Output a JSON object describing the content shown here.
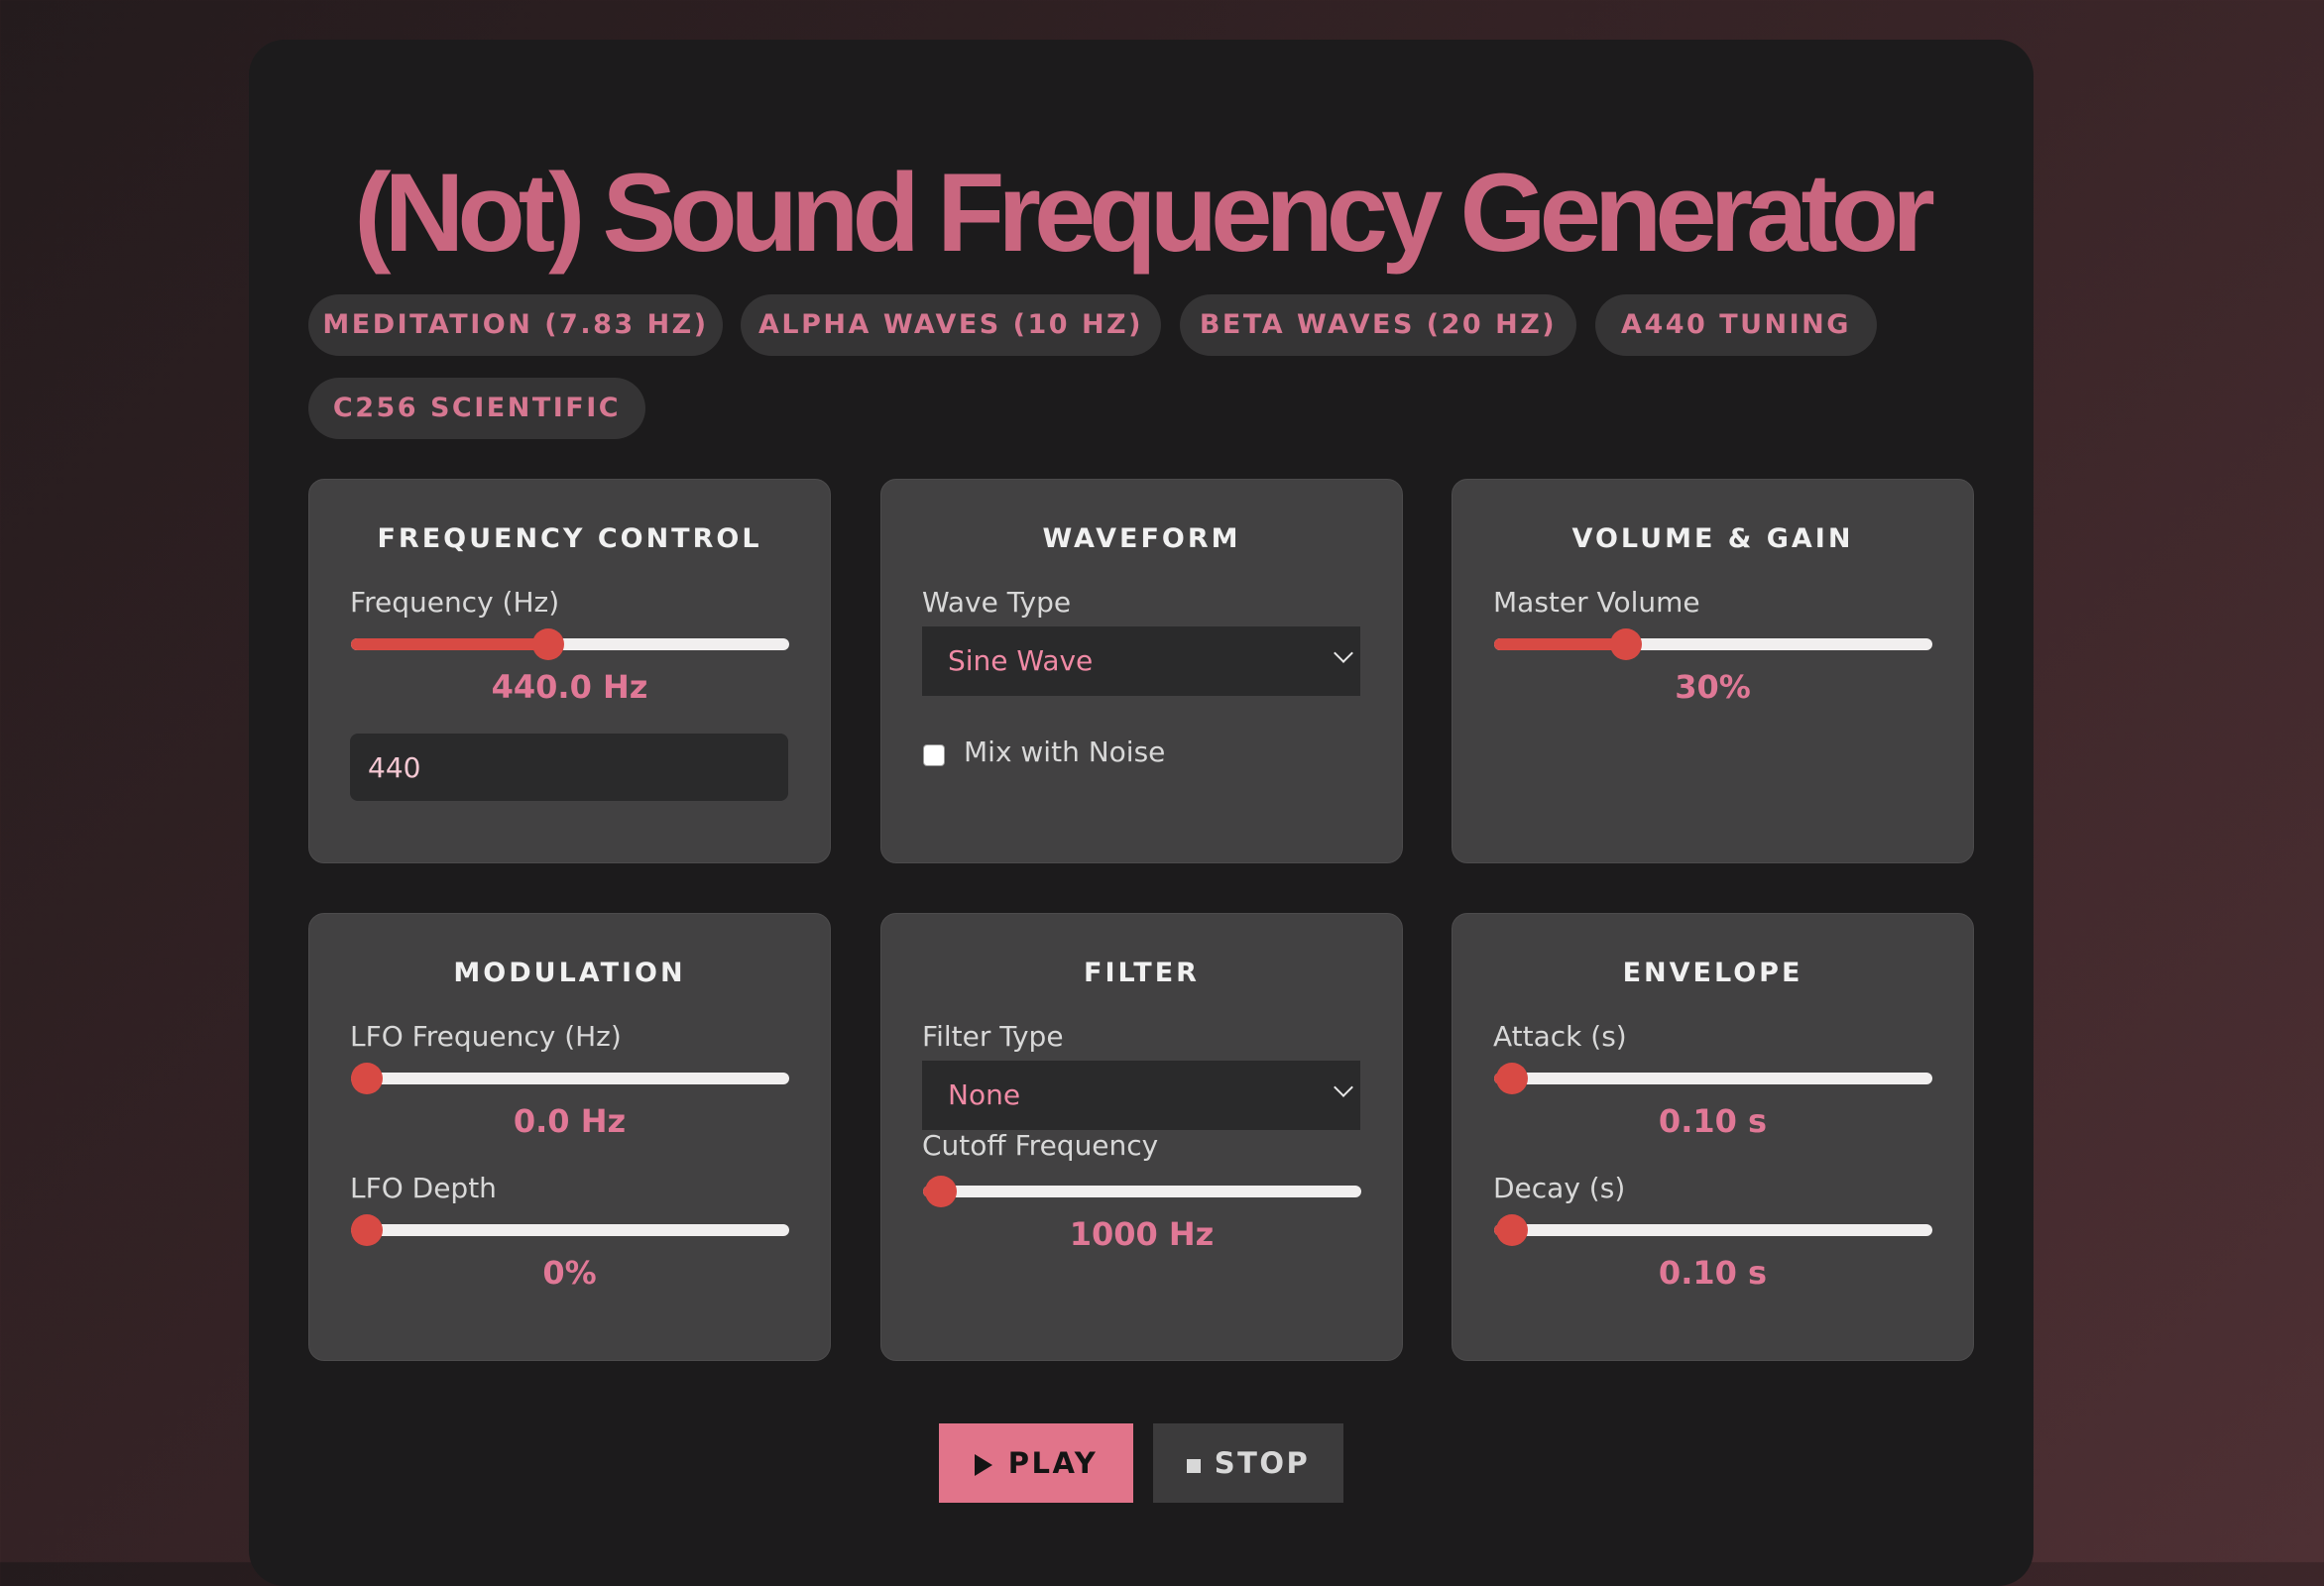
{
  "title": "(Not) Sound Frequency Generator",
  "presets": [
    "Meditation (7.83 Hz)",
    "Alpha Waves (10 Hz)",
    "Beta Waves (20 Hz)",
    "A440 Tuning",
    "C256 Scientific"
  ],
  "frequency": {
    "title": "Frequency Control",
    "label": "Frequency (Hz)",
    "slider_fraction": 0.45,
    "display": "440.0 Hz",
    "input_value": "440"
  },
  "waveform": {
    "title": "Waveform",
    "label": "Wave Type",
    "selected": "Sine Wave",
    "noise_label": "Mix with Noise",
    "noise_checked": false
  },
  "volume": {
    "title": "Volume & Gain",
    "label": "Master Volume",
    "slider_fraction": 0.3,
    "display": "30%"
  },
  "modulation": {
    "title": "Modulation",
    "lfo_freq_label": "LFO Frequency (Hz)",
    "lfo_freq_fraction": 0.0,
    "lfo_freq_display": "0.0 Hz",
    "lfo_depth_label": "LFO Depth",
    "lfo_depth_fraction": 0.0,
    "lfo_depth_display": "0%"
  },
  "filter": {
    "title": "Filter",
    "type_label": "Filter Type",
    "selected": "None",
    "cutoff_label": "Cutoff Frequency",
    "cutoff_fraction": 0.04,
    "cutoff_display": "1000 Hz"
  },
  "envelope": {
    "title": "Envelope",
    "attack_label": "Attack (s)",
    "attack_fraction": 0.04,
    "attack_display": "0.10 s",
    "decay_label": "Decay (s)",
    "decay_fraction": 0.04,
    "decay_display": "0.10 s"
  },
  "controls": {
    "play_label": "PLAY",
    "stop_label": "STOP"
  },
  "colors": {
    "accent": "#c9667f",
    "slider": "#d84a44",
    "play_bg": "#e1748a"
  }
}
